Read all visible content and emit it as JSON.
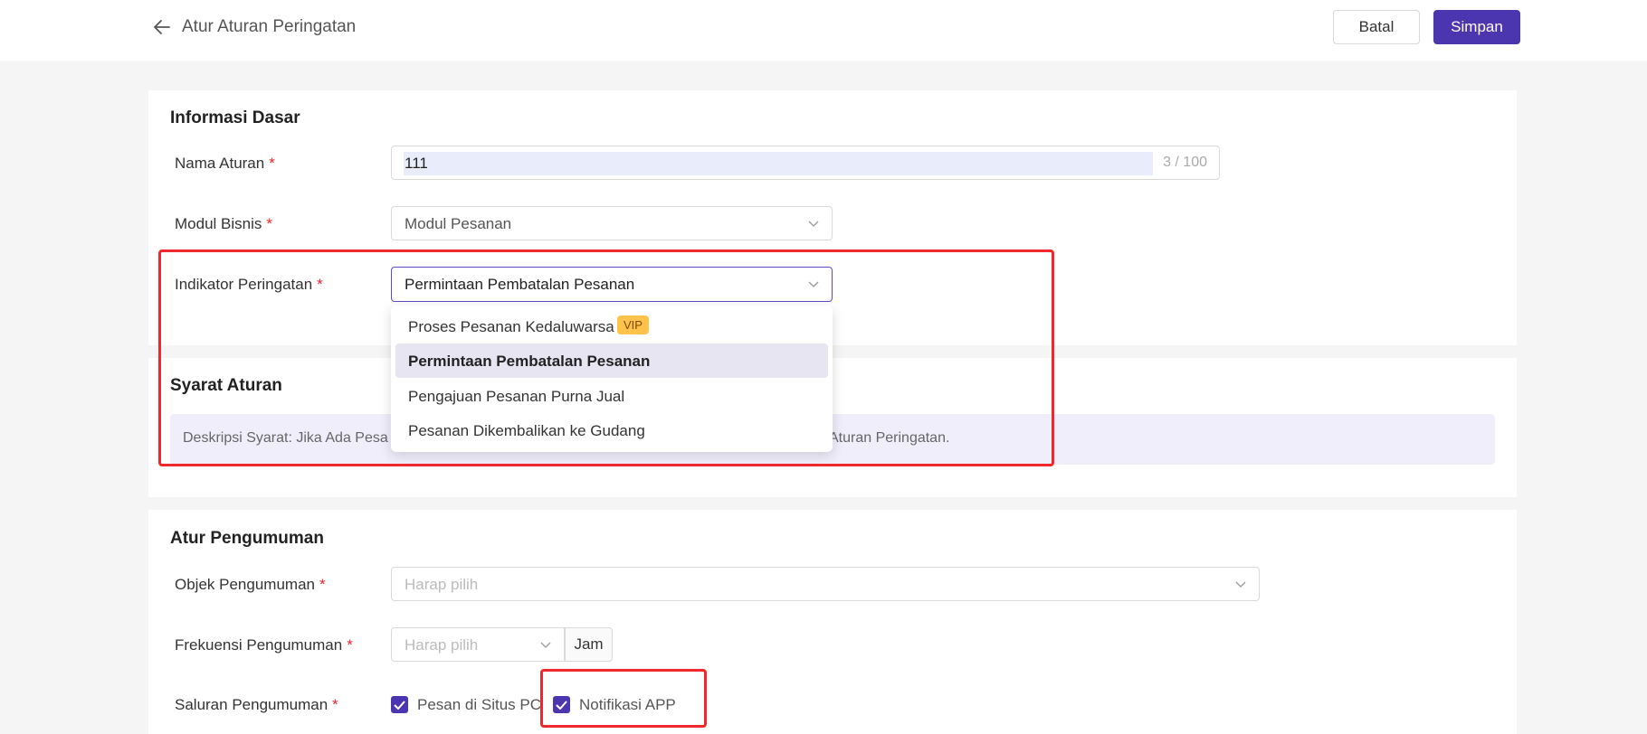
{
  "header": {
    "title": "Atur Aturan Peringatan",
    "cancel_label": "Batal",
    "save_label": "Simpan"
  },
  "basic_info": {
    "title": "Informasi Dasar",
    "rule_name": {
      "label": "Nama Aturan",
      "required": "*",
      "value": "111",
      "counter": "3 / 100"
    },
    "business_module": {
      "label": "Modul Bisnis",
      "required": "*",
      "value": "Modul Pesanan"
    },
    "warning_indicator": {
      "label": "Indikator Peringatan",
      "required": "*",
      "value": "Permintaan Pembatalan Pesanan",
      "options": [
        {
          "label": "Proses Pesanan Kedaluwarsa",
          "badge": "VIP"
        },
        {
          "label": "Permintaan Pembatalan Pesanan",
          "selected": true
        },
        {
          "label": "Pengajuan Pesanan Purna Jual"
        },
        {
          "label": "Pesanan Dikembalikan ke Gudang"
        }
      ]
    }
  },
  "conditions": {
    "title": "Syarat Aturan",
    "desc_visible_left": "Deskripsi Syarat: Jika Ada Pesa",
    "desc_visible_right": "Aturan Peringatan."
  },
  "announcement": {
    "title": "Atur Pengumuman",
    "object": {
      "label": "Objek Pengumuman",
      "required": "*",
      "placeholder": "Harap pilih"
    },
    "frequency": {
      "label": "Frekuensi Pengumuman",
      "required": "*",
      "placeholder": "Harap pilih",
      "unit": "Jam"
    },
    "channel": {
      "label": "Saluran Pengumuman",
      "required": "*",
      "options": [
        {
          "label": "Pesan di Situs PC",
          "checked": true
        },
        {
          "label": "Notifikasi APP",
          "checked": true
        }
      ]
    }
  },
  "colors": {
    "accent": "#4b36b0",
    "highlight_box": "#f0282d",
    "vip_badge": "#ffc24a"
  }
}
